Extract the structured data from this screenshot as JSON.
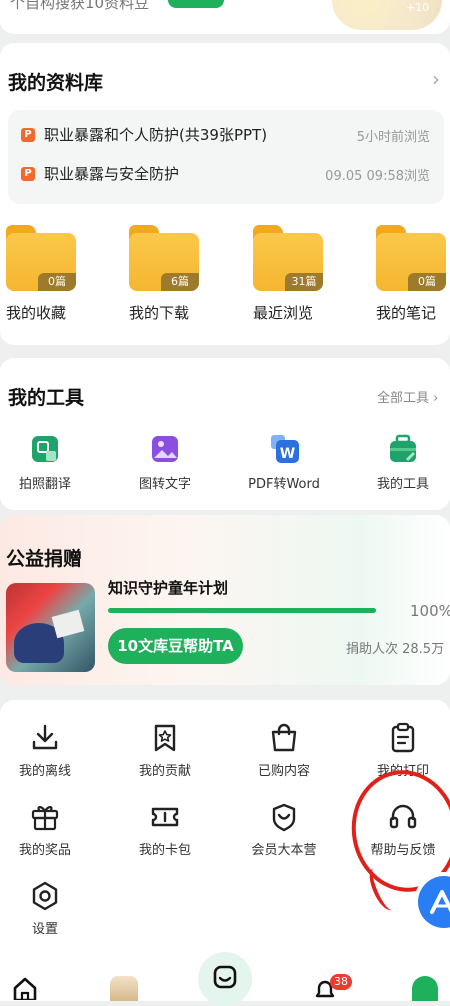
{
  "top_strip": {
    "partial_text": "个自构搜获10资料豆",
    "coin_count": "+10"
  },
  "library": {
    "title": "我的资料库",
    "recent": [
      {
        "badge": "P",
        "title": "职业暴露和个人防护(共39张PPT)",
        "time": "5小时前浏览"
      },
      {
        "badge": "P",
        "title": "职业暴露与安全防护",
        "time": "09.05 09:58浏览"
      }
    ],
    "folders": [
      {
        "label": "我的收藏",
        "count": "0篇"
      },
      {
        "label": "我的下载",
        "count": "6篇"
      },
      {
        "label": "最近浏览",
        "count": "31篇"
      },
      {
        "label": "我的笔记",
        "count": "0篇"
      }
    ]
  },
  "tools": {
    "title": "我的工具",
    "all_label": "全部工具",
    "items": [
      {
        "label": "拍照翻译",
        "icon": "photo-translate-icon"
      },
      {
        "label": "图转文字",
        "icon": "image-to-text-icon"
      },
      {
        "label": "PDF转Word",
        "icon": "pdf-to-word-icon"
      },
      {
        "label": "我的工具",
        "icon": "toolbox-icon"
      }
    ]
  },
  "charity": {
    "title": "公益捐赠",
    "project": "知识守护童年计划",
    "progress": 100,
    "progress_label": "100%",
    "button": "10文库豆帮助TA",
    "stat": "捐助人次 28.5万"
  },
  "services": [
    {
      "label": "我的离线",
      "icon": "download-icon"
    },
    {
      "label": "我的贡献",
      "icon": "bookmark-star-icon"
    },
    {
      "label": "已购内容",
      "icon": "shopping-bag-icon"
    },
    {
      "label": "我的打印",
      "icon": "clipboard-icon"
    },
    {
      "label": "我的奖品",
      "icon": "gift-icon"
    },
    {
      "label": "我的卡包",
      "icon": "card-icon"
    },
    {
      "label": "会员大本营",
      "icon": "vip-heart-icon"
    },
    {
      "label": "帮助与反馈",
      "icon": "headset-icon"
    },
    {
      "label": "设置",
      "icon": "settings-icon"
    }
  ],
  "bottom_nav": {
    "notification_badge": "38"
  },
  "colors": {
    "brand_green": "#1eb05b",
    "annotation_red": "#e0211a"
  }
}
